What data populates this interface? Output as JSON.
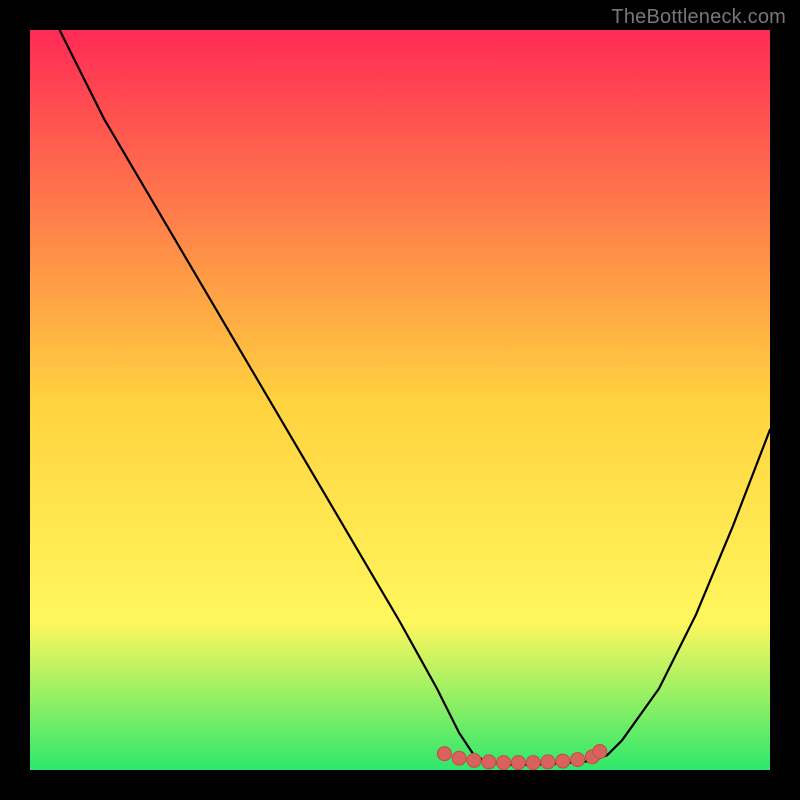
{
  "watermark": "TheBottleneck.com",
  "colors": {
    "gradient_top": "#ff2a55",
    "gradient_upper_mid": "#ffd23f",
    "gradient_lower_mid": "#fff75e",
    "gradient_bottom": "#2ee86b",
    "curve": "#000000",
    "marker_fill": "#d9625d",
    "marker_stroke": "#c14d48",
    "frame": "#000000"
  },
  "chart_data": {
    "type": "line",
    "title": "",
    "xlabel": "",
    "ylabel": "",
    "xlim": [
      0,
      100
    ],
    "ylim": [
      0,
      100
    ],
    "grid": false,
    "legend": false,
    "annotations": [],
    "series": [
      {
        "name": "bottleneck-curve",
        "x": [
          4,
          10,
          20,
          30,
          40,
          50,
          55,
          58,
          60,
          62,
          65,
          68,
          70,
          73,
          76,
          78,
          80,
          85,
          90,
          95,
          100
        ],
        "y": [
          100,
          88,
          71,
          54,
          37,
          20,
          11,
          5,
          2,
          1,
          0.7,
          0.7,
          0.8,
          1,
          1.2,
          2,
          4,
          11,
          21,
          33,
          46
        ]
      }
    ],
    "markers": [
      {
        "name": "optimum-region",
        "x": [
          56,
          58,
          60,
          62,
          64,
          66,
          68,
          70,
          72,
          74,
          76,
          77
        ],
        "y": [
          2.2,
          1.6,
          1.3,
          1.1,
          1.0,
          1.0,
          1.0,
          1.1,
          1.2,
          1.4,
          1.8,
          2.5
        ]
      }
    ]
  }
}
